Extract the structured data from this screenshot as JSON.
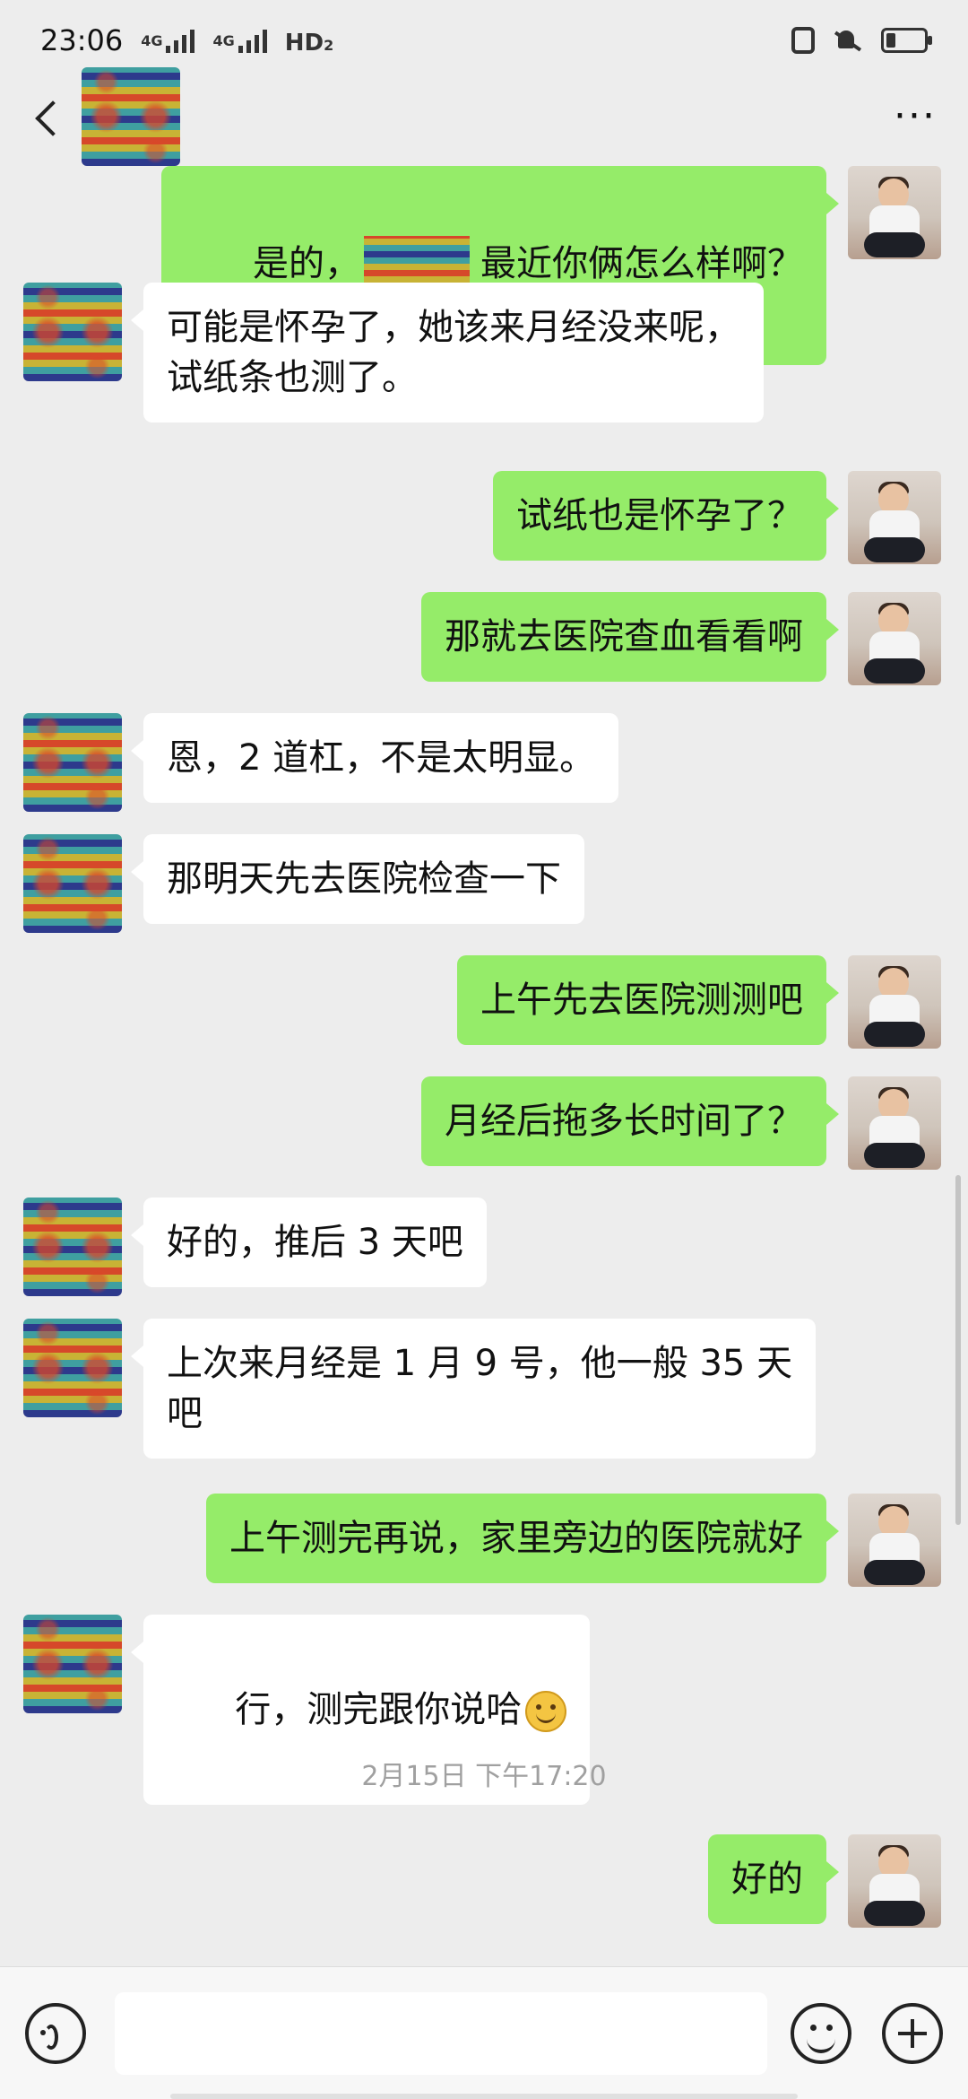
{
  "status_bar": {
    "time": "23:06",
    "network_labels": [
      "4G",
      "4G"
    ],
    "hd_label": "HD",
    "hd_sub": "2"
  },
  "header": {
    "back_icon": "chevron-left-icon",
    "more_label": "···"
  },
  "messages": [
    {
      "side": "right",
      "parts": [
        "是的，",
        "",
        "最近你俩怎么样啊？"
      ]
    },
    {
      "side": "left",
      "text": "可能是怀孕了，她该来月经没来呢，\n试纸条也测了。"
    },
    {
      "side": "right",
      "text": "试纸也是怀孕了？"
    },
    {
      "side": "right",
      "text": "那就去医院查血看看啊"
    },
    {
      "side": "left",
      "text": "恩，2 道杠，不是太明显。"
    },
    {
      "side": "left",
      "text": "那明天先去医院检查一下"
    },
    {
      "side": "right",
      "text": "上午先去医院测测吧"
    },
    {
      "side": "right",
      "text": "月经后拖多长时间了？"
    },
    {
      "side": "left",
      "text": "好的，推后 3 天吧"
    },
    {
      "side": "left",
      "text": "上次来月经是 1 月 9 号，他一般 35 天\n吧"
    },
    {
      "side": "right",
      "text": "上午测完再说，家里旁边的医院就好"
    },
    {
      "side": "left",
      "text": "行，测完跟你说哈",
      "emoji": "smile-icon"
    },
    {
      "side": "right",
      "text": "好的"
    }
  ],
  "timestamp": "2月15日 下午17:20",
  "input_bar": {
    "voice_icon": "voice-icon",
    "emoji_icon": "smiley-icon",
    "plus_icon": "plus-icon",
    "input_value": ""
  },
  "colors": {
    "background": "#ededed",
    "sent_bubble": "#95ec69",
    "received_bubble": "#ffffff",
    "timestamp": "#a0a0a0"
  }
}
